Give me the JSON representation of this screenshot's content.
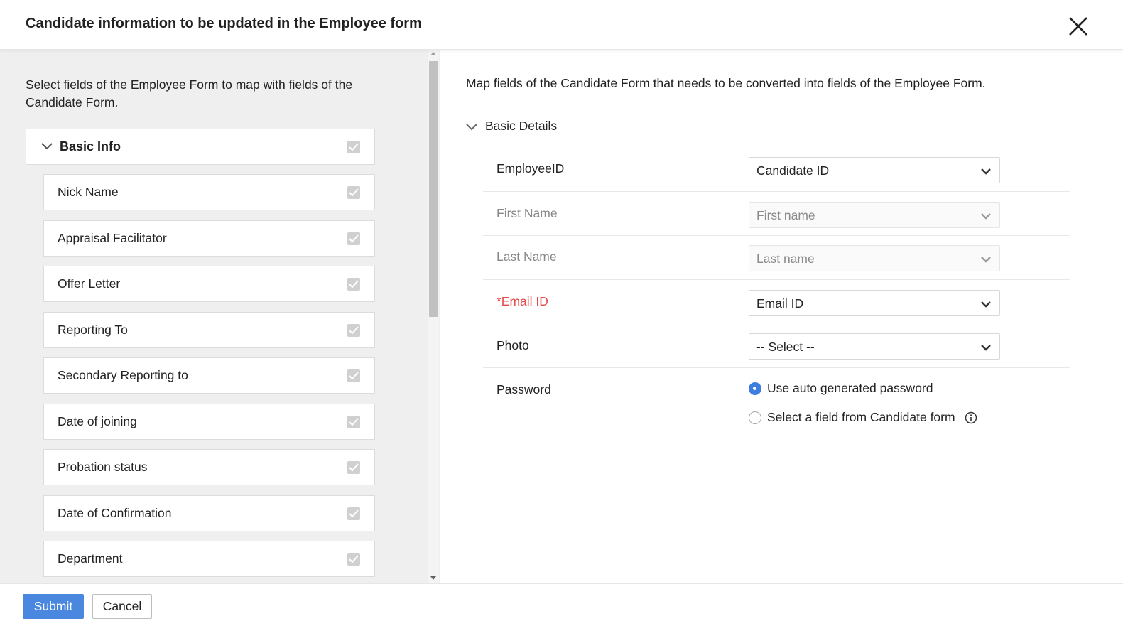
{
  "header": {
    "title": "Candidate information to be updated in the Employee form",
    "close_icon": "close-icon"
  },
  "left_panel": {
    "description": "Select fields of the Employee Form to map with fields of the Candidate Form.",
    "group": {
      "label": "Basic Info",
      "checked": true
    },
    "fields": [
      {
        "label": "Nick Name",
        "checked": true
      },
      {
        "label": "Appraisal Facilitator",
        "checked": true
      },
      {
        "label": "Offer Letter",
        "checked": true
      },
      {
        "label": "Reporting To",
        "checked": true
      },
      {
        "label": "Secondary Reporting to",
        "checked": true
      },
      {
        "label": "Date of joining",
        "checked": true
      },
      {
        "label": "Probation status",
        "checked": true
      },
      {
        "label": "Date of Confirmation",
        "checked": true
      },
      {
        "label": "Department",
        "checked": true
      }
    ]
  },
  "right_panel": {
    "description": "Map fields of the Candidate Form that needs to be converted into fields of the Employee Form.",
    "section_label": "Basic Details",
    "mappings": [
      {
        "label": "EmployeeID",
        "value": "Candidate ID",
        "disabled": false
      },
      {
        "label": "First Name",
        "value": "First name",
        "disabled": true
      },
      {
        "label": "Last Name",
        "value": "Last name",
        "disabled": true
      },
      {
        "label": "*Email ID",
        "value": "Email ID",
        "disabled": false,
        "required": true
      },
      {
        "label": "Photo",
        "value": "-- Select --",
        "disabled": false
      }
    ],
    "password": {
      "label": "Password",
      "options": [
        {
          "label": "Use auto generated password",
          "selected": true
        },
        {
          "label": "Select a field from Candidate form",
          "selected": false
        }
      ]
    }
  },
  "footer": {
    "submit_label": "Submit",
    "cancel_label": "Cancel"
  },
  "colors": {
    "accent": "#4a88e0",
    "required": "#e64a4a",
    "panel_bg": "#efefef"
  }
}
